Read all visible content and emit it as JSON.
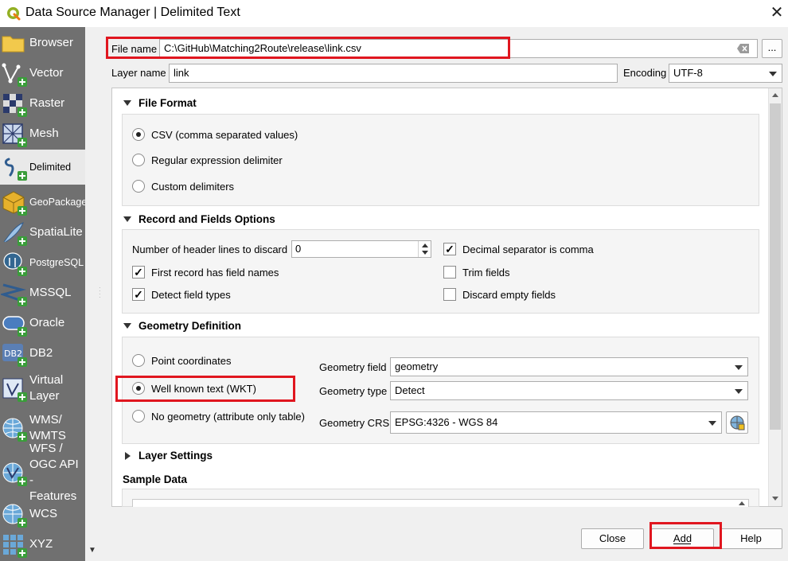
{
  "window": {
    "title": "Data Source Manager | Delimited Text"
  },
  "sidebar": {
    "items": [
      {
        "label": "Browser"
      },
      {
        "label": "Vector"
      },
      {
        "label": "Raster"
      },
      {
        "label": "Mesh"
      },
      {
        "label": "Delimited"
      },
      {
        "label": "GeoPackage"
      },
      {
        "label": "SpatiaLite"
      },
      {
        "label": "PostgreSQL"
      },
      {
        "label": "MSSQL"
      },
      {
        "label": "Oracle"
      },
      {
        "label": "DB2"
      },
      {
        "label": "Virtual Layer"
      },
      {
        "label": "WMS/ WMTS"
      },
      {
        "label": "WFS / OGC API - Features"
      },
      {
        "label": "WCS"
      },
      {
        "label": "XYZ"
      }
    ],
    "selected": "Delimited"
  },
  "file": {
    "label": "File name",
    "value": "C:\\GitHub\\Matching2Route\\release\\link.csv",
    "browse": "..."
  },
  "layer": {
    "label": "Layer name",
    "value": "link"
  },
  "encoding": {
    "label": "Encoding",
    "value": "UTF-8"
  },
  "file_format": {
    "title": "File Format",
    "options": [
      "CSV (comma separated values)",
      "Regular expression delimiter",
      "Custom delimiters"
    ],
    "selected": "CSV (comma separated values)"
  },
  "record_fields": {
    "title": "Record and Fields Options",
    "header_lines_label": "Number of header lines to discard",
    "header_lines_value": "0",
    "first_record": "First record has field names",
    "detect_types": "Detect field types",
    "decimal_comma": "Decimal separator is comma",
    "trim_fields": "Trim fields",
    "discard_empty": "Discard empty fields",
    "checked": [
      "First record has field names",
      "Detect field types",
      "Decimal separator is comma"
    ]
  },
  "geometry": {
    "title": "Geometry Definition",
    "options": [
      "Point coordinates",
      "Well known text (WKT)",
      "No geometry (attribute only table)"
    ],
    "selected": "Well known text (WKT)",
    "field_label": "Geometry field",
    "field_value": "geometry",
    "type_label": "Geometry type",
    "type_value": "Detect",
    "crs_label": "Geometry CRS",
    "crs_value": "EPSG:4326 - WGS 84"
  },
  "layer_settings": {
    "title": "Layer Settings"
  },
  "sample_data": {
    "title": "Sample Data"
  },
  "buttons": {
    "close": "Close",
    "add": "Add",
    "help": "Help"
  },
  "colors": {
    "highlight": "#e0161f",
    "sidebar": "#707070",
    "selected_item": "#e9e9e9"
  },
  "icons": [
    "qgis-logo-icon",
    "close-icon",
    "folder-icon",
    "vector-icon",
    "raster-icon",
    "mesh-icon",
    "delimited-icon",
    "geopackage-icon",
    "spatialite-icon",
    "postgresql-icon",
    "mssql-icon",
    "oracle-icon",
    "db2-icon",
    "virtual-layer-icon",
    "wms-icon",
    "wfs-icon",
    "wcs-icon",
    "xyz-icon",
    "crs-selector-icon"
  ]
}
